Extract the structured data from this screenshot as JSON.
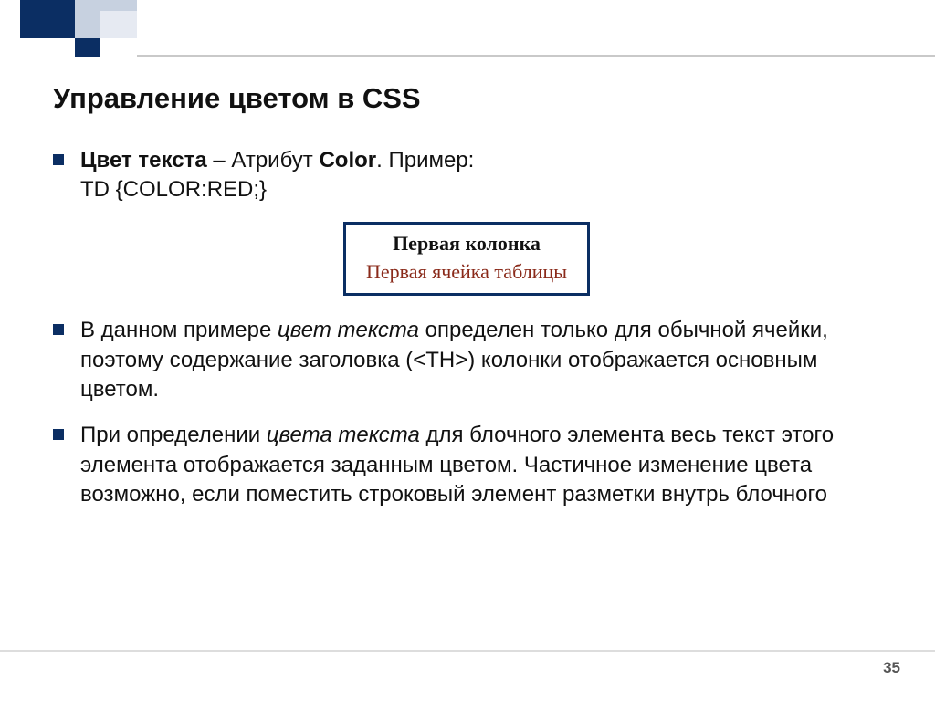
{
  "title": "Управление цветом в CSS",
  "bullets": {
    "b0_part1": "Цвет текста",
    "b0_part2": " – Атрибут ",
    "b0_part3": "Color",
    "b0_part4": ". Пример:",
    "b0_line2_a": "TD {COLOR:",
    "b0_line2_b": "RED",
    "b0_line2_c": ";}",
    "b1_a": "В данном примере ",
    "b1_b": "цвет текста",
    "b1_c": " определен только для обычной ячейки, поэтому содержание заголовка (<TH>) колонки отображается основным цветом.",
    "b2_a": "При определении ",
    "b2_b": "цвета текста",
    "b2_c": " для блочного элемента весь текст этого элемента отображается заданным цветом. Частичное изменение цвета возможно, если поместить строковый элемент разметки внутрь блочного"
  },
  "example": {
    "th": "Первая колонка",
    "td": "Первая ячейка таблицы"
  },
  "page_number": "35"
}
